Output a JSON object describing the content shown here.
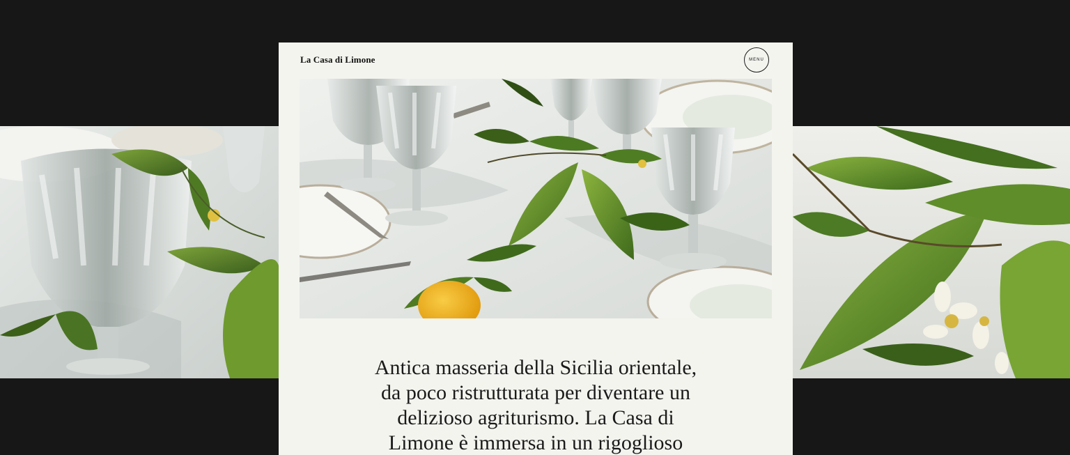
{
  "header": {
    "brand": "La Casa di Limone",
    "menu_label": "MENU"
  },
  "hero": {
    "image_subject": "table-setting-with-lemon-branches"
  },
  "side_images": {
    "left_subject": "crystal-glass-and-lemon-leaves",
    "right_subject": "lemon-branch-with-blossoms"
  },
  "intro": {
    "text": "Antica masseria della Sicilia orientale,\nda poco ristrutturata per diventare un\ndelizioso agriturismo. La Casa di\nLimone è immersa in un rigoglioso"
  },
  "colors": {
    "background": "#171717",
    "card": "#f4f4ef",
    "text": "#1a1a1a",
    "leaf": "#5d8a2a",
    "lemon": "#f0b21f"
  }
}
